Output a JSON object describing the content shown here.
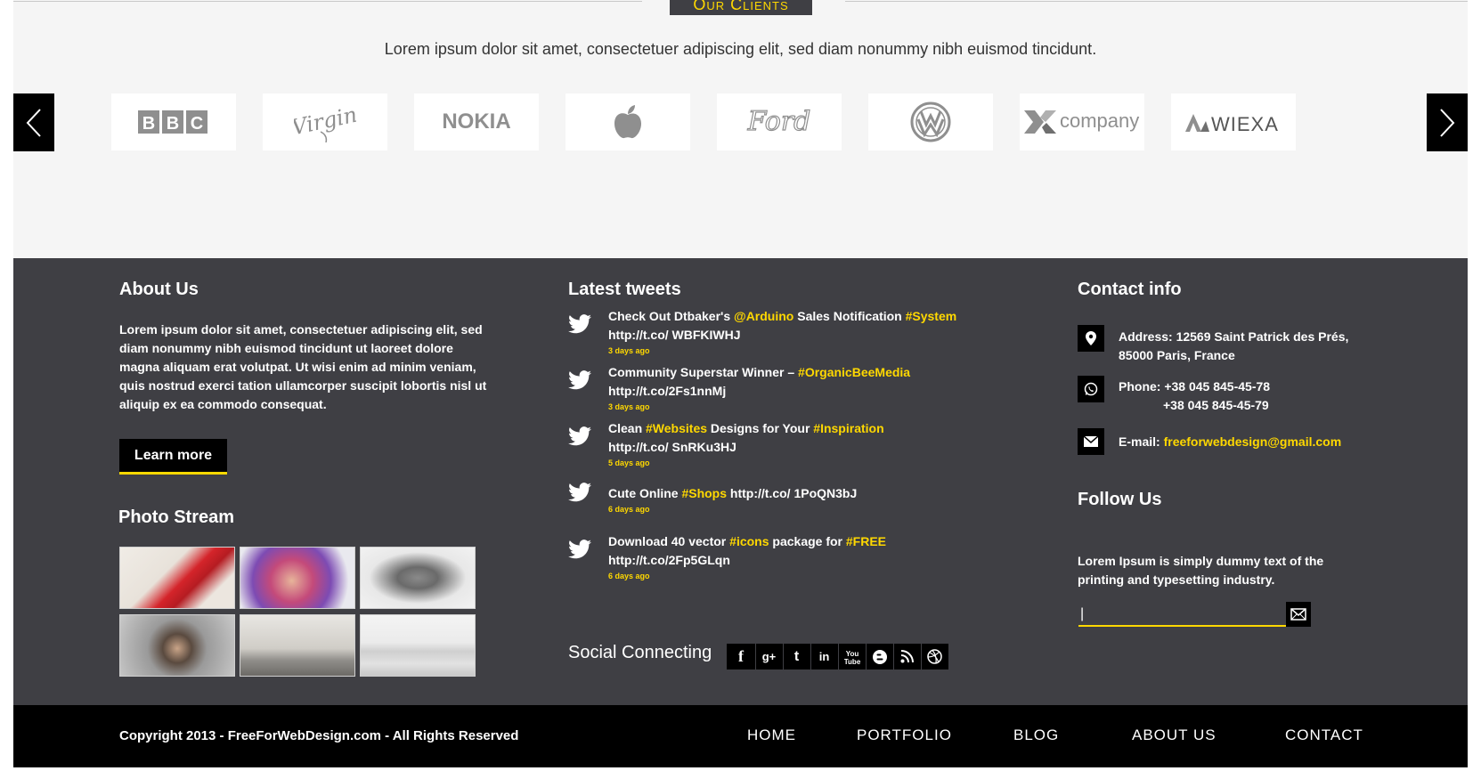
{
  "clients": {
    "title": "Our Clients",
    "intro": "Lorem ipsum dolor sit amet, consectetuer adipiscing elit, sed diam nonummy nibh euismod tincidunt.",
    "logos": [
      {
        "name": "BBC",
        "icon": "bbc-logo"
      },
      {
        "name": "Virgin",
        "icon": "virgin-logo"
      },
      {
        "name": "NOKIA",
        "icon": "nokia-logo"
      },
      {
        "name": "Apple",
        "icon": "apple-logo"
      },
      {
        "name": "Ford",
        "icon": "ford-logo"
      },
      {
        "name": "Volkswagen",
        "icon": "vw-logo"
      },
      {
        "name": "company",
        "icon": "xcompany-logo"
      },
      {
        "name": "WIEXA",
        "icon": "wiexa-logo"
      }
    ],
    "prev_icon": "chevron-left-icon",
    "next_icon": "chevron-right-icon"
  },
  "footer": {
    "about": {
      "title": "About Us",
      "text": "Lorem ipsum dolor sit amet, consectetuer adipiscing elit, sed diam nonummy nibh euismod tincidunt ut laoreet dolore magna aliquam erat volutpat. Ut wisi enim ad minim veniam, quis nostrud exerci tation ullamcorper suscipit lobortis nisl ut aliquip ex ea commodo consequat.",
      "button": "Learn more"
    },
    "photo_stream": {
      "title": "Photo Stream"
    },
    "tweets": {
      "title": "Latest tweets",
      "items": [
        {
          "p1": "Check Out Dtbaker's ",
          "h1": "@Arduino",
          "p2": " Sales Notification ",
          "h2": "#System",
          "link": "http://t.co/ WBFKIWHJ",
          "ago": "3 days ago"
        },
        {
          "p1": "Community Superstar Winner – ",
          "h1": "#OrganicBeeMedia",
          "p2": "",
          "h2": "",
          "link": "http://t.co/2Fs1nnMj",
          "ago": "3 days ago"
        },
        {
          "p1": "Clean ",
          "h1": "#Websites",
          "p2": " Designs for Your ",
          "h2": "#Inspiration",
          "link": "http://t.co/ SnRKu3HJ",
          "ago": "5 days ago"
        },
        {
          "p1": "Cute Online ",
          "h1": "#Shops",
          "p2": " http://t.co/ 1PoQN3bJ",
          "h2": "",
          "link": "",
          "ago": "6 days ago"
        },
        {
          "p1": "Download 40 vector ",
          "h1": "#icons",
          "p2": " package for ",
          "h2": "#FREE",
          "link": "http://t.co/2Fp5GLqn",
          "ago": "6 days ago"
        }
      ]
    },
    "social": {
      "title": "Social Connecting",
      "items": [
        "facebook-icon",
        "google-plus-icon",
        "twitter-icon",
        "linkedin-icon",
        "youtube-icon",
        "blogger-icon",
        "rss-icon",
        "dribbble-icon"
      ]
    },
    "contact": {
      "title": "Contact info",
      "address_label": "Address: ",
      "address_line1": "12569 Saint Patrick des Prés,",
      "address_line2": "85000 Paris, France",
      "phone_label": "Phone: ",
      "phone1": "+38 045 845-45-78",
      "phone2": "+38 045 845-45-79",
      "email_label": "E-mail: ",
      "email": "freeforwebdesign@gmail.com"
    },
    "follow": {
      "title": "Follow Us",
      "text": "Lorem Ipsum is simply dummy text of the printing and typesetting industry.",
      "input_value": "|"
    }
  },
  "bottombar": {
    "copyright": "Copyright 2013 - FreeForWebDesign.com - All Rights Reserved",
    "nav": [
      "HOME",
      "PORTFOLIO",
      "BLOG",
      "ABOUT US",
      "CONTACT"
    ]
  },
  "colors": {
    "accent": "#ffd800",
    "footer_bg": "#3f3f44",
    "clients_bg": "#f5f5f5"
  }
}
